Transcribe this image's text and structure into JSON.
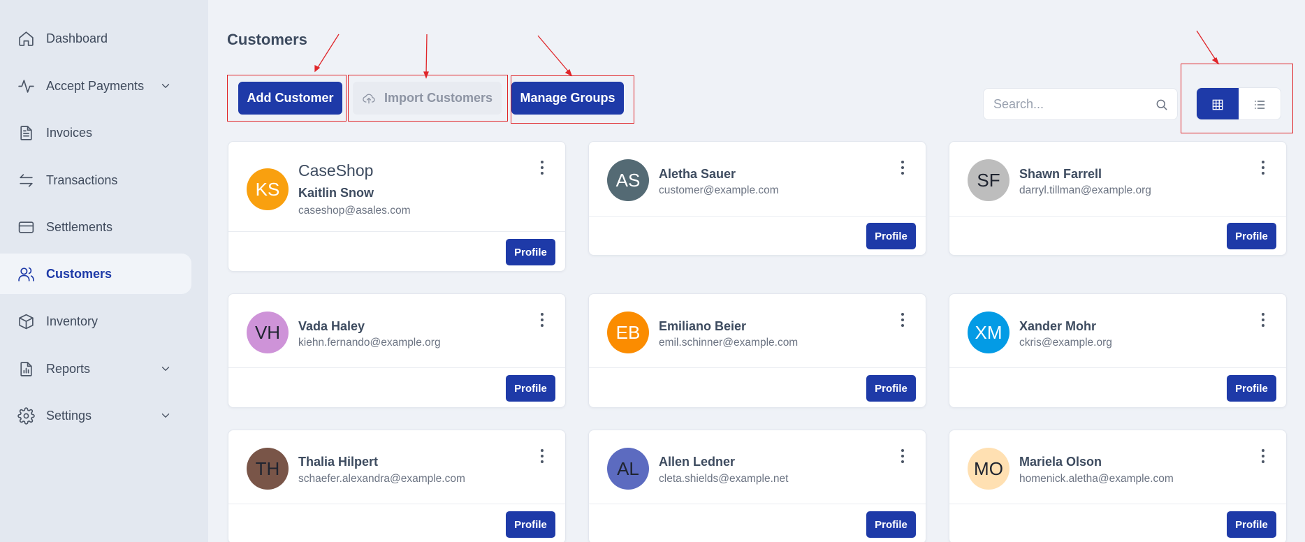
{
  "sidebar": {
    "items": [
      {
        "label": "Dashboard",
        "icon": "home-icon"
      },
      {
        "label": "Accept Payments",
        "icon": "pulse-icon",
        "expandable": true
      },
      {
        "label": "Invoices",
        "icon": "document-icon"
      },
      {
        "label": "Transactions",
        "icon": "arrows-swap-icon"
      },
      {
        "label": "Settlements",
        "icon": "card-icon"
      },
      {
        "label": "Customers",
        "icon": "users-icon",
        "active": true
      },
      {
        "label": "Inventory",
        "icon": "box-icon"
      },
      {
        "label": "Reports",
        "icon": "chart-file-icon",
        "expandable": true
      },
      {
        "label": "Settings",
        "icon": "gear-icon",
        "expandable": true
      }
    ]
  },
  "header": {
    "title": "Customers",
    "add_customer_label": "Add Customer",
    "import_customers_label": "Import Customers",
    "manage_groups_label": "Manage Groups",
    "search_placeholder": "Search...",
    "view_mode": "grid"
  },
  "colors": {
    "primary": "#1e3aa8",
    "annotation": "#e0262a",
    "sidebar_bg": "#e3e8f0",
    "page_bg": "#eff2f7"
  },
  "customers": [
    {
      "initials": "KS",
      "company": "CaseShop",
      "name": "Kaitlin Snow",
      "email": "caseshop@asales.com",
      "avatar_color": "#f9a00f",
      "profile_label": "Profile"
    },
    {
      "initials": "AS",
      "name": "Aletha Sauer",
      "email": "customer@example.com",
      "avatar_color": "#546a74",
      "profile_label": "Profile"
    },
    {
      "initials": "SF",
      "name": "Shawn Farrell",
      "email": "darryl.tillman@example.org",
      "avatar_color": "#bdbdbd",
      "profile_label": "Profile"
    },
    {
      "initials": "VH",
      "name": "Vada Haley",
      "email": "kiehn.fernando@example.org",
      "avatar_color": "#ce93d8",
      "profile_label": "Profile"
    },
    {
      "initials": "EB",
      "name": "Emiliano Beier",
      "email": "emil.schinner@example.com",
      "avatar_color": "#fb8c00",
      "profile_label": "Profile"
    },
    {
      "initials": "XM",
      "name": "Xander Mohr",
      "email": "ckris@example.org",
      "avatar_color": "#039be5",
      "profile_label": "Profile"
    },
    {
      "initials": "TH",
      "name": "Thalia Hilpert",
      "email": "schaefer.alexandra@example.com",
      "avatar_color": "#795548",
      "profile_label": "Profile"
    },
    {
      "initials": "AL",
      "name": "Allen Ledner",
      "email": "cleta.shields@example.net",
      "avatar_color": "#5c6bc0",
      "profile_label": "Profile"
    },
    {
      "initials": "MO",
      "name": "Mariela Olson",
      "email": "homenick.aletha@example.com",
      "avatar_color": "#ffe0b2",
      "profile_label": "Profile"
    }
  ]
}
